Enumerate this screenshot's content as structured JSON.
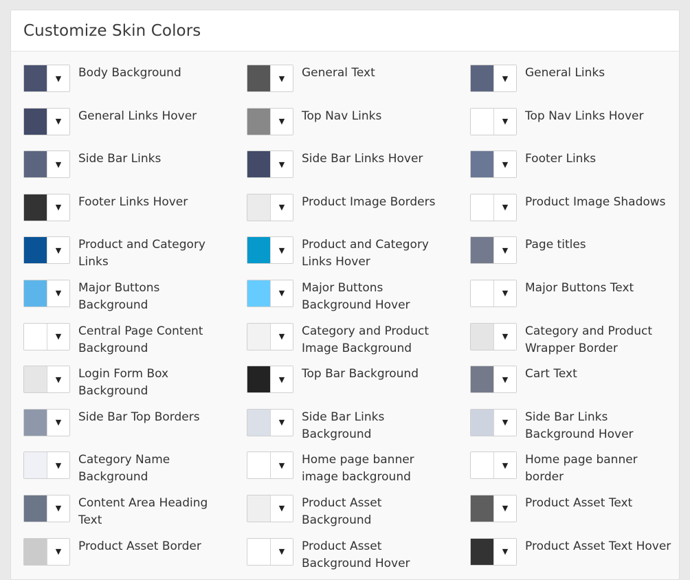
{
  "panel": {
    "title": "Customize Skin Colors"
  },
  "icons": {
    "caret": "▼"
  },
  "items": [
    {
      "label": "Body Background",
      "color": "#4a526f"
    },
    {
      "label": "General Text",
      "color": "#575757"
    },
    {
      "label": "General Links",
      "color": "#5c6580"
    },
    {
      "label": "General Links Hover",
      "color": "#434b68"
    },
    {
      "label": "Top Nav Links",
      "color": "#888888"
    },
    {
      "label": "Top Nav Links Hover",
      "color": "#ffffff"
    },
    {
      "label": "Side Bar Links",
      "color": "#5c6580"
    },
    {
      "label": "Side Bar Links Hover",
      "color": "#434b68"
    },
    {
      "label": "Footer Links",
      "color": "#6a7795"
    },
    {
      "label": "Footer Links Hover",
      "color": "#333333"
    },
    {
      "label": "Product Image Borders",
      "color": "#ebebeb"
    },
    {
      "label": "Product Image Shadows",
      "color": "#ffffff"
    },
    {
      "label": "Product and Category Links",
      "color": "#0a5397"
    },
    {
      "label": "Product and Category Links Hover",
      "color": "#0599cc"
    },
    {
      "label": "Page titles",
      "color": "#747a8e"
    },
    {
      "label": "Major Buttons Background",
      "color": "#5bb5ea"
    },
    {
      "label": "Major Buttons Background Hover",
      "color": "#66ccff"
    },
    {
      "label": "Major Buttons Text",
      "color": "#ffffff"
    },
    {
      "label": "Central Page Content Background",
      "color": "#ffffff"
    },
    {
      "label": "Category and Product Image Background",
      "color": "#f2f2f2"
    },
    {
      "label": "Category and Product Wrapper Border",
      "color": "#e5e5e5"
    },
    {
      "label": "Login Form Box Background",
      "color": "#e6e6e6"
    },
    {
      "label": "Top Bar Background",
      "color": "#232323"
    },
    {
      "label": "Cart Text",
      "color": "#747a8a"
    },
    {
      "label": "Side Bar Top Borders",
      "color": "#8f98aa"
    },
    {
      "label": "Side Bar Links Background",
      "color": "#dadfe8"
    },
    {
      "label": "Side Bar Links Background Hover",
      "color": "#ced3e0"
    },
    {
      "label": "Category Name Background",
      "color": "#eff1f7"
    },
    {
      "label": "Home page banner image background",
      "color": "#ffffff"
    },
    {
      "label": "Home page banner border",
      "color": "#ffffff"
    },
    {
      "label": "Content Area Heading Text",
      "color": "#6c7689"
    },
    {
      "label": "Product Asset Background",
      "color": "#efefef"
    },
    {
      "label": "Product Asset Text",
      "color": "#5e5e5e"
    },
    {
      "label": "Product Asset Border",
      "color": "#cbcbcb"
    },
    {
      "label": "Product Asset Background Hover",
      "color": "#ffffff"
    },
    {
      "label": "Product Asset Text Hover",
      "color": "#333333"
    }
  ]
}
